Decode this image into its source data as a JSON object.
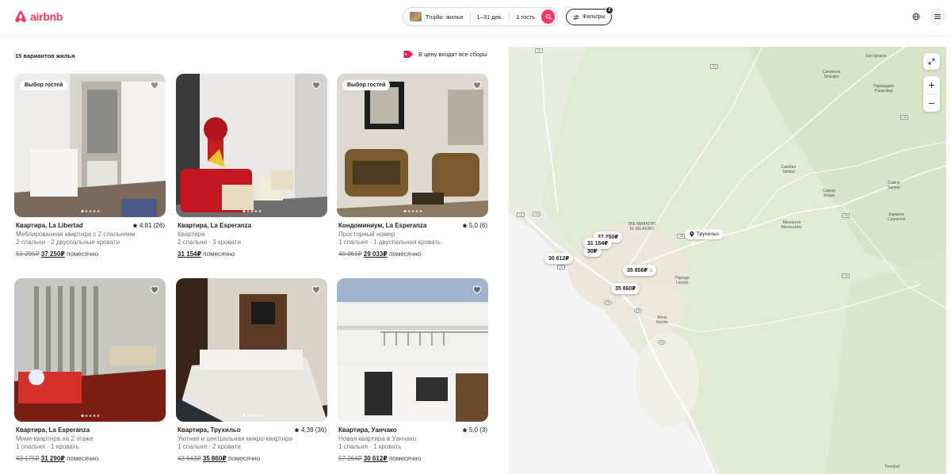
{
  "header": {
    "logo_text": "airbnb",
    "search": {
      "location": "Trujillo: жилье",
      "dates": "1–31 дек.",
      "guests": "1 гость"
    },
    "filters_label": "Фильтры",
    "filters_count": "2",
    "brand_color": "#ff385c"
  },
  "results": {
    "count_label": "15 вариантов жилья",
    "price_notice": "В цену входят все сборы"
  },
  "listings": [
    {
      "badge": "Выбор гостей",
      "title": "Квартира, La Libertad",
      "rating": "4,81 (26)",
      "line1": "Меблированная квартира с 2 спальнями",
      "line2": "2 спальни · 2 двуспальные кровати",
      "old_price": "51 295₽",
      "price": "37 250₽",
      "per": "помесячно"
    },
    {
      "badge": "",
      "title": "Квартира, La Esperanza",
      "rating": "",
      "line1": "Квартира",
      "line2": "2 спальни · 3 кровати",
      "old_price": "",
      "price": "31 154₽",
      "per": "помесячно"
    },
    {
      "badge": "Выбор гостей",
      "title": "Кондоминиум, La Esperanza",
      "rating": "5,0 (6)",
      "line1": "Просторный номер",
      "line2": "1 спальня · 1 двуспальная кровать",
      "old_price": "40 061₽",
      "price": "29 033₽",
      "per": "помесячно"
    },
    {
      "badge": "",
      "title": "Квартира, La Esperanza",
      "rating": "",
      "line1": "Мини-квартира на 2 этаже",
      "line2": "1 спальня · 1 кровать",
      "old_price": "43 175₽",
      "price": "31 290₽",
      "per": "помесячно"
    },
    {
      "badge": "",
      "title": "Квартира, Трухильо",
      "rating": "4,39 (36)",
      "line1": "Уютная и центральная микро-квартира",
      "line2": "1 спальня · 2 кровати",
      "old_price": "43 643₽",
      "price": "35 860₽",
      "per": "помесячно"
    },
    {
      "badge": "",
      "title": "Квартира, Уанчако",
      "rating": "5,0 (3)",
      "line1": "Новая квартира в Уанчако",
      "line2": "1 спальня · 1 кровать",
      "old_price": "57 264₽",
      "price": "30 612₽",
      "per": "помесячно"
    }
  ],
  "map": {
    "city_label": "Трухильо",
    "price_pins": [
      "37 250₽",
      "31 154₽",
      "30 612₽",
      "35 856₽",
      "35 860₽"
    ],
    "partial_pin": "30₽",
    "places": {
      "san_ignacio": "San Ignacio",
      "sinicape": "Синикапе\nSinicape",
      "parandayi": "Парандайи\nParandayi",
      "simbal": "Симбал\nSimbal",
      "menocucho": "Менокучо\nMenocucho",
      "sirgan": "Сирган\nSirgan",
      "samne": "Самне\nSamne",
      "caumiche": "Каумиче\nCaumiche",
      "el_milagro": "ЭЛЬ МИЛАГРО\nEL MILAGRO",
      "laredo": "Паредо\nLaredo",
      "moche": "Моче\nMoche",
      "tomabal": "Tomabal"
    },
    "road_shields": [
      "1N",
      "10A",
      "10B",
      "1N",
      "10A",
      "1N",
      "10B",
      "1N",
      "1N",
      "10A",
      "10A",
      "1N"
    ]
  }
}
